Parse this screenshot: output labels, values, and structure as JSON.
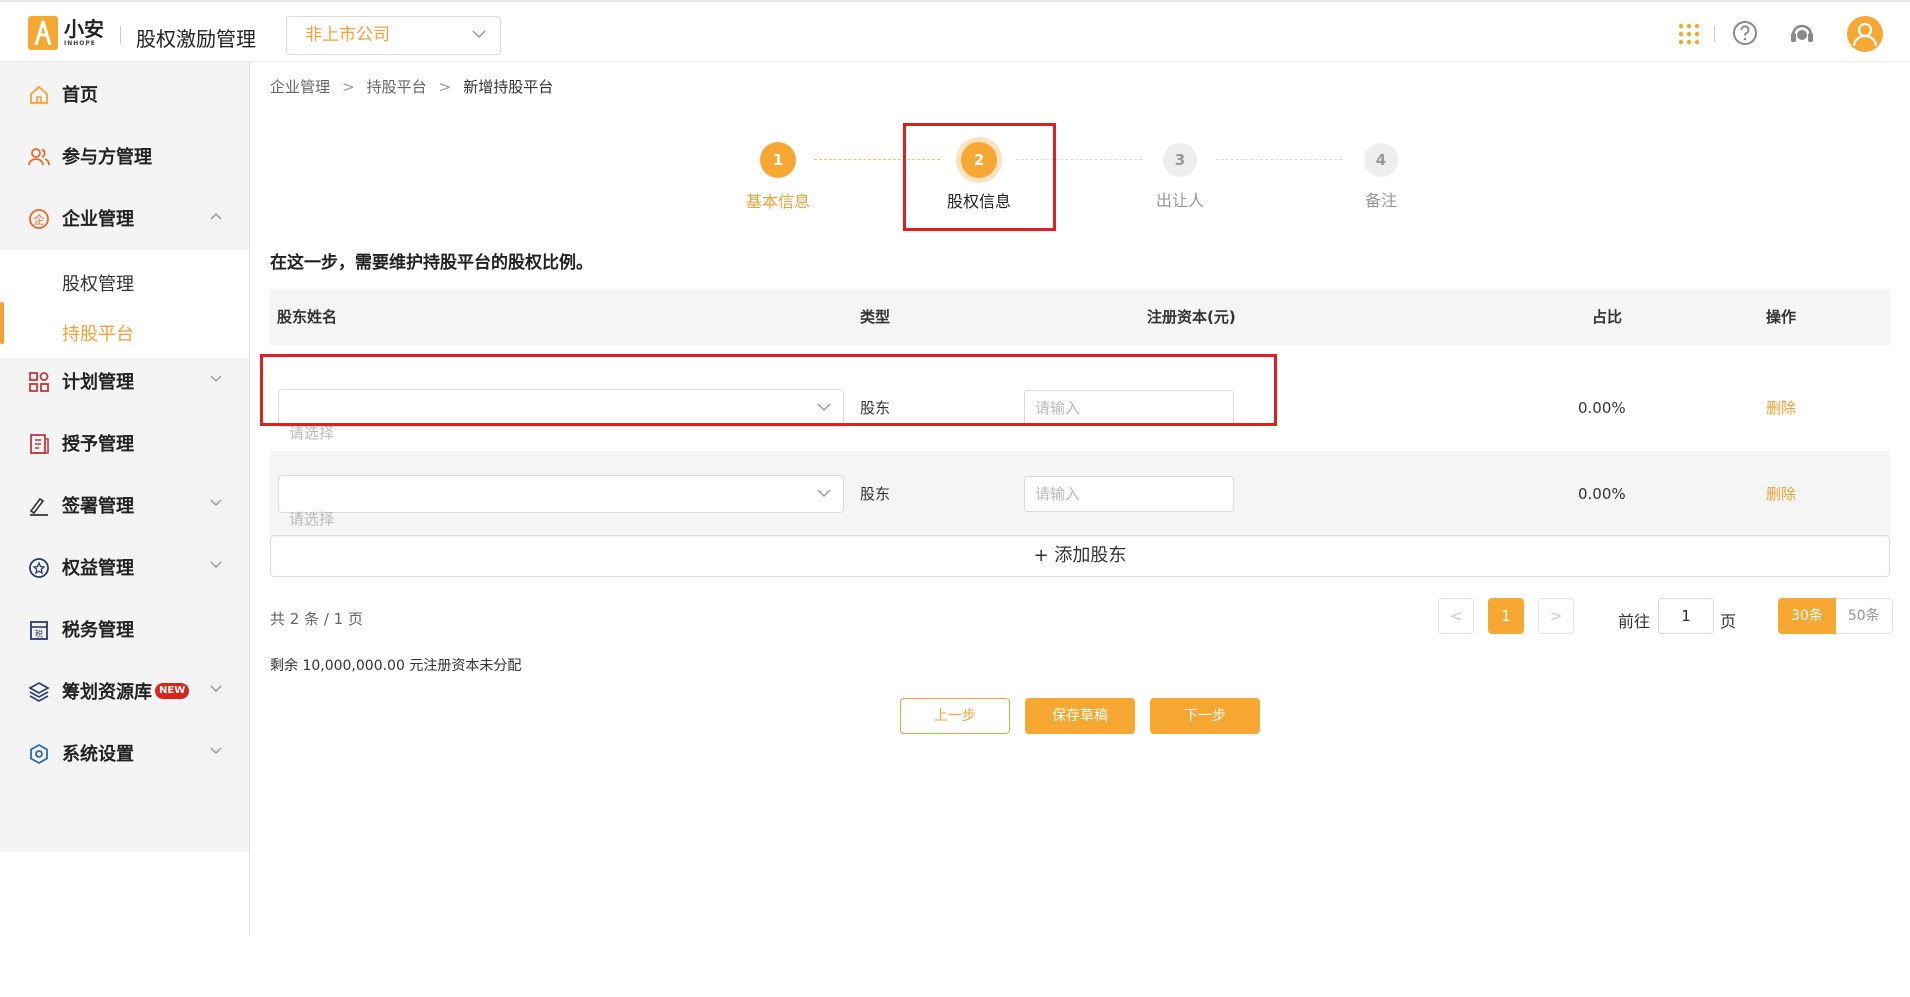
{
  "header": {
    "logo_cn": "小安",
    "logo_en": "INHOPE",
    "app_title": "股权激励管理",
    "company_select": "非上市公司",
    "icons": [
      "apps-grid-icon",
      "help-icon",
      "customer-service-icon",
      "user-avatar-icon"
    ]
  },
  "sidebar": {
    "items": [
      {
        "label": "首页",
        "icon": "home-icon"
      },
      {
        "label": "参与方管理",
        "icon": "users-icon"
      },
      {
        "label": "企业管理",
        "icon": "enterprise-icon",
        "expanded": true
      },
      {
        "label": "计划管理",
        "icon": "plan-icon"
      },
      {
        "label": "授予管理",
        "icon": "grant-icon"
      },
      {
        "label": "签署管理",
        "icon": "sign-icon"
      },
      {
        "label": "权益管理",
        "icon": "rights-icon"
      },
      {
        "label": "税务管理",
        "icon": "tax-icon"
      },
      {
        "label": "筹划资源库",
        "icon": "layers-icon",
        "badge": "NEW"
      },
      {
        "label": "系统设置",
        "icon": "settings-icon"
      }
    ],
    "sub_items": [
      {
        "label": "股权管理"
      },
      {
        "label": "持股平台",
        "active": true
      }
    ]
  },
  "breadcrumb": [
    "企业管理",
    "持股平台",
    "新增持股平台"
  ],
  "steps": [
    {
      "num": "1",
      "label": "基本信息",
      "state": "done"
    },
    {
      "num": "2",
      "label": "股权信息",
      "state": "current"
    },
    {
      "num": "3",
      "label": "出让人",
      "state": "todo"
    },
    {
      "num": "4",
      "label": "备注",
      "state": "todo"
    }
  ],
  "intro": "在这一步，需要维护持股平台的股权比例。",
  "table": {
    "headers": [
      "股东姓名",
      "类型",
      "注册资本(元)",
      "占比",
      "操作"
    ],
    "rows": [
      {
        "name_placeholder": "请选择",
        "type": "股东",
        "capital_placeholder": "请输入",
        "ratio": "0.00%",
        "action": "删除"
      },
      {
        "name_placeholder": "请选择",
        "type": "股东",
        "capital_placeholder": "请输入",
        "ratio": "0.00%",
        "action": "删除"
      }
    ]
  },
  "add_button": "添加股东",
  "pagination": {
    "total": "共 2 条 / 1 页",
    "current": "1",
    "goto_label": "前往",
    "goto_value": "1",
    "page_unit": "页",
    "sizes": [
      "30条",
      "50条"
    ]
  },
  "remain_text": "剩余 10,000,000.00 元注册资本未分配",
  "buttons": {
    "prev": "上一步",
    "save": "保存草稿",
    "next": "下一步"
  },
  "colors": {
    "accent": "#f7a833",
    "highlight_box": "#e02020"
  }
}
